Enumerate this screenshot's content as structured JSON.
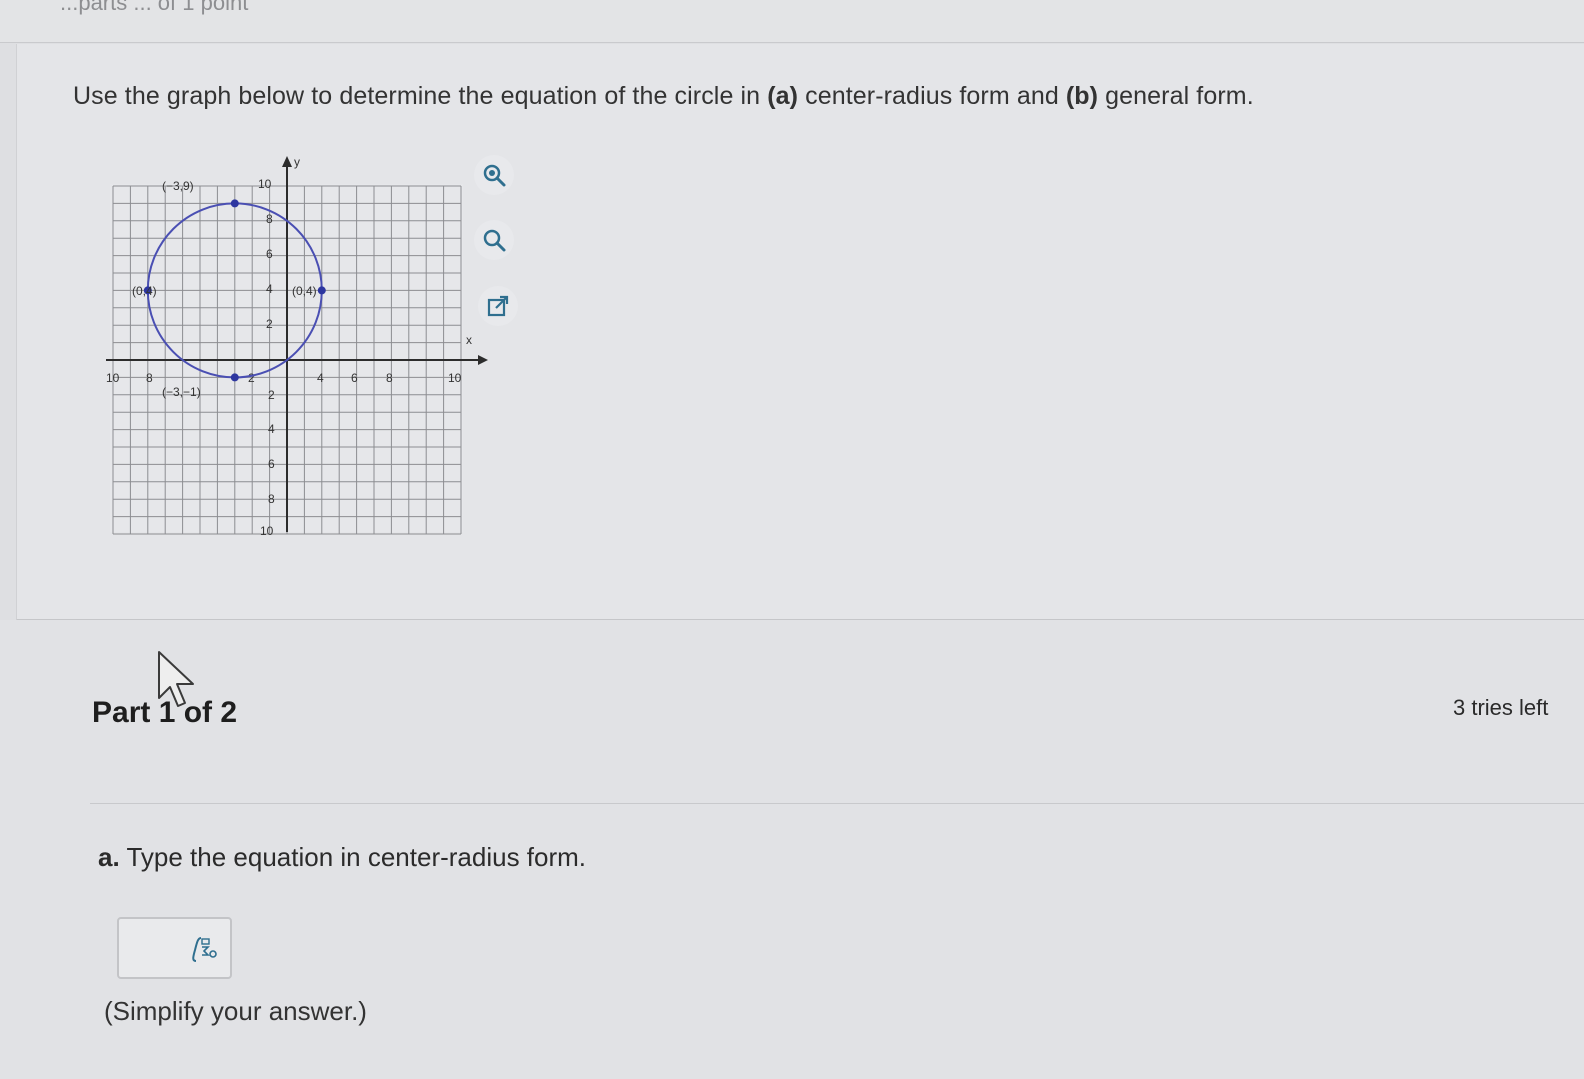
{
  "header": {
    "partial_text": "...parts ... of 1 point"
  },
  "question": {
    "prompt_pre": "Use the graph below to determine the equation of the circle in ",
    "prompt_a": "(a)",
    "prompt_mid": " center-radius form and ",
    "prompt_b": "(b)",
    "prompt_post": " general form."
  },
  "graph": {
    "axis_x": "x",
    "axis_y": "y",
    "point_top": "(−3,9)",
    "point_left": "(0,4)",
    "point_right": "(0,4)",
    "point_bottom": "(−3,−1)",
    "ticks_x": [
      "10",
      "8",
      "2",
      "4",
      "6",
      "8",
      "10"
    ],
    "ticks_y": [
      "10",
      "8",
      "6",
      "4",
      "2",
      "2",
      "4",
      "6",
      "8",
      "10"
    ]
  },
  "tools": {
    "zoom_in": "zoom-in-icon",
    "zoom_out": "zoom-out-icon",
    "popout": "external-link-icon"
  },
  "part": {
    "label": "Part 1 of 2",
    "tries": "3 tries left"
  },
  "answer": {
    "instruction_prefix": "a.",
    "instruction_text": " Type the equation in center-radius form.",
    "value": "",
    "placeholder": "",
    "hint": "(Simplify your answer.)"
  },
  "colors": {
    "circle": "#4a4fb3",
    "point": "#2d36a0",
    "grid": "#8c8d91"
  }
}
